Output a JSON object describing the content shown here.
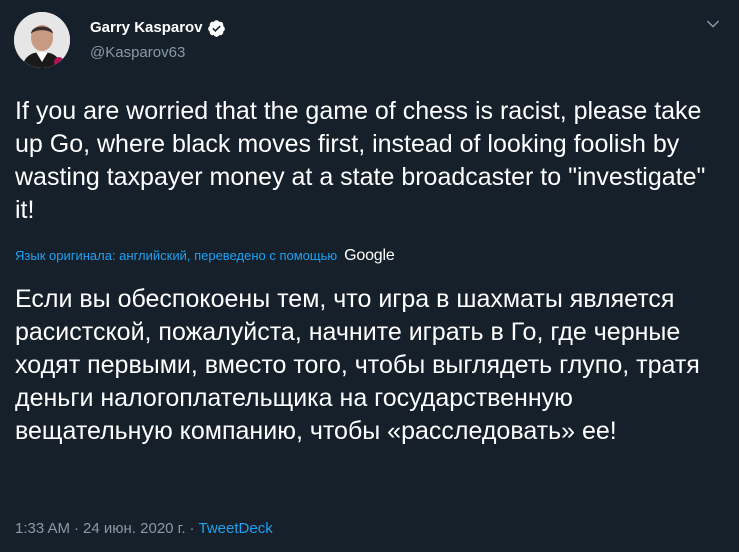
{
  "author": {
    "display_name": "Garry Kasparov",
    "handle": "@Kasparov63",
    "verified": true,
    "avatar_icon": "avatar-portrait-icon"
  },
  "tweet": {
    "text": "If you are worried that the game of chess is racist, please take up Go, where black moves first, instead of looking foolish by wasting taxpayer money at a state broadcaster to \"investigate\" it!",
    "translation_label": "Язык оригинала: английский, переведено с помощью",
    "translation_provider": "Google",
    "translated_text": "Если вы обеспокоены тем, что игра в шахматы является расистской, пожалуйста, начните играть в Го, где черные ходят первыми, вместо того, чтобы выглядеть глупо, тратя деньги налогоплательщика на государственную вещательную компанию, чтобы «расследовать» ее!"
  },
  "meta": {
    "time": "1:33 AM",
    "separator": "·",
    "date": "24 июн. 2020 г.",
    "source": "TweetDeck"
  },
  "colors": {
    "background": "#15202b",
    "text_primary": "#ffffff",
    "text_secondary": "#8899a6",
    "accent": "#1da1f2"
  }
}
